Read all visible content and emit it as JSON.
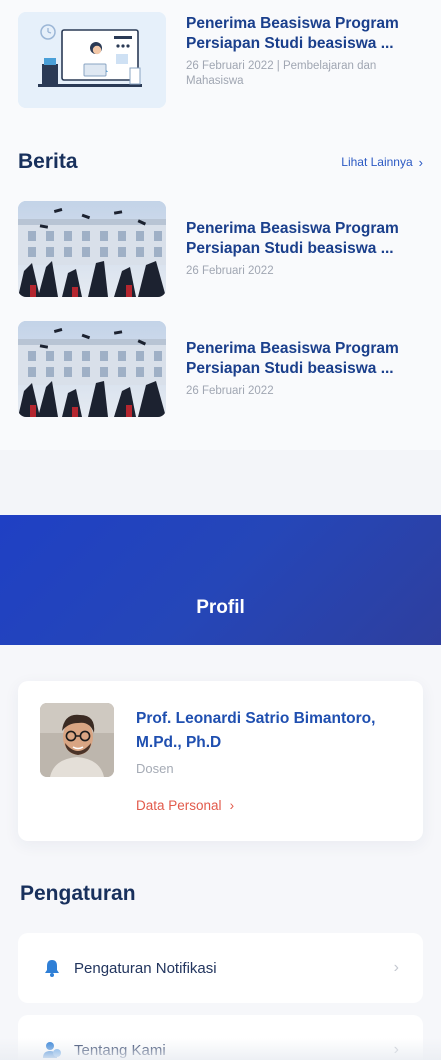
{
  "news_top": {
    "title": "Penerima Beasiswa Program Persiapan Studi beasiswa ...",
    "meta": "26 Februari 2022 | Pembelajaran dan Mahasiswa"
  },
  "berita": {
    "title": "Berita",
    "see_more": "Lihat Lainnya",
    "items": [
      {
        "title": "Penerima Beasiswa Program Persiapan Studi beasiswa ...",
        "date": "26 Februari 2022"
      },
      {
        "title": "Penerima Beasiswa Program Persiapan Studi beasiswa ...",
        "date": "26 Februari 2022"
      }
    ]
  },
  "profile": {
    "header_title": "Profil",
    "name": "Prof. Leonardi Satrio Bimantoro, M.Pd., Ph.D",
    "role": "Dosen",
    "link_label": "Data Personal"
  },
  "settings": {
    "title": "Pengaturan",
    "items": [
      {
        "label": "Pengaturan Notifikasi",
        "icon": "bell-icon"
      },
      {
        "label": "Tentang Kami",
        "icon": "people-icon"
      }
    ]
  },
  "colors": {
    "brand_blue": "#1f4fb0",
    "header_gradient_start": "#1f40c4",
    "header_gradient_end": "#2e3f9e",
    "link_red": "#e25a4b",
    "heading_dark": "#18305c"
  }
}
